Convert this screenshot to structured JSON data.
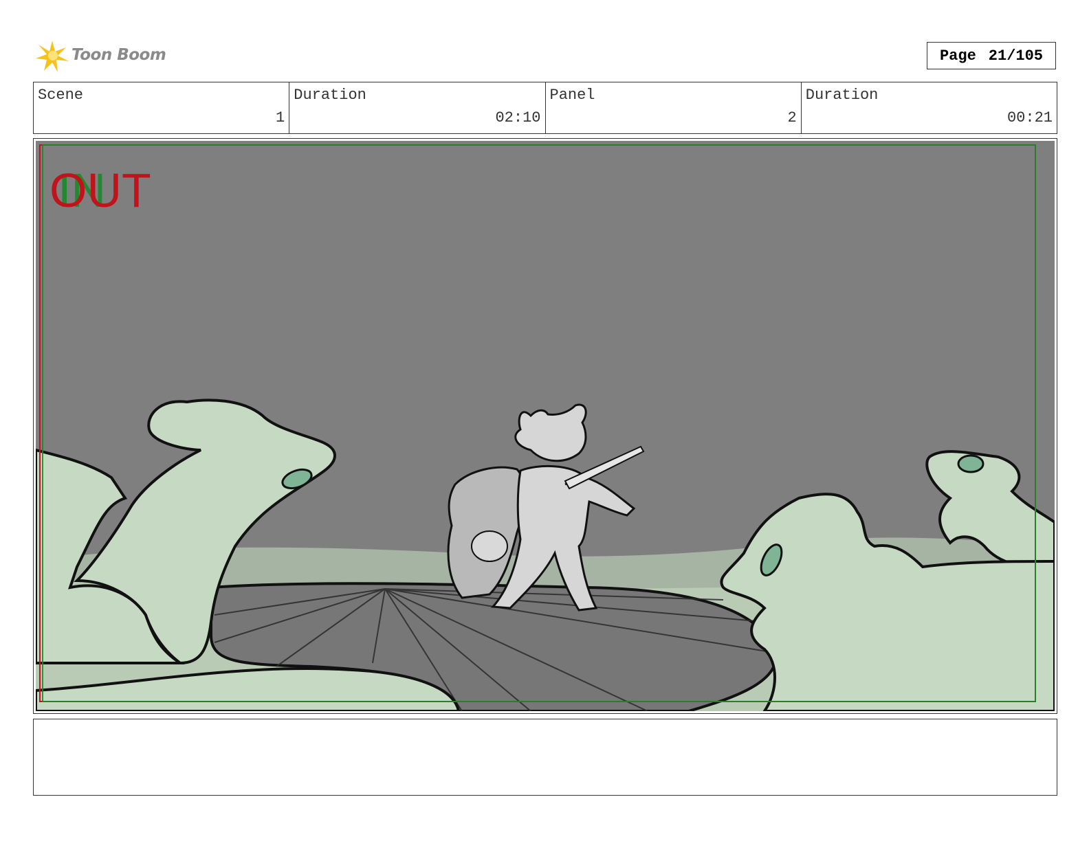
{
  "header": {
    "logo_text": "Toon Boom",
    "page_label": "Page",
    "page_number": "21/105"
  },
  "info": [
    {
      "label": "Scene",
      "value": "1"
    },
    {
      "label": "Duration",
      "value": "02:10"
    },
    {
      "label": "Panel",
      "value": "2"
    },
    {
      "label": "Duration",
      "value": "00:21"
    }
  ],
  "panel": {
    "overlay_in": "IN",
    "overlay_out": "OUT"
  },
  "notes": {
    "text": ""
  },
  "colors": {
    "sky": "#7f7f7f",
    "ground_green": "#c9dbc5",
    "rock_green": "#c6d9c2",
    "frame_red": "#c0141c",
    "frame_green": "#1a8a2a",
    "logo_yellow": "#f6c21c"
  }
}
